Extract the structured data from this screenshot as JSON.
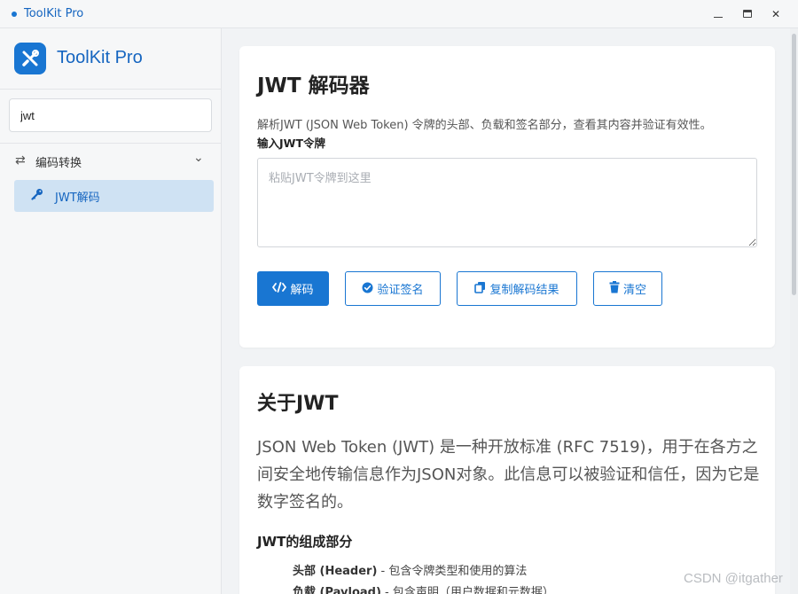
{
  "window": {
    "title": "ToolKit Pro",
    "accent_color": "#1976d2",
    "controls": {
      "minimize_icon": "minimize-icon",
      "maximize_icon": "maximize-icon",
      "close": "✕"
    }
  },
  "sidebar": {
    "brand_name": "ToolKit Pro",
    "brand_icon": "tools-icon",
    "search": {
      "value": "jwt",
      "placeholder": ""
    },
    "category": {
      "icon": "⇄",
      "label": "编码转换",
      "chevron": "⌄"
    },
    "items": [
      {
        "icon": "key-icon",
        "label": "JWT解码",
        "active": true
      }
    ]
  },
  "main": {
    "decoder": {
      "title": "JWT 解码器",
      "description": "解析JWT (JSON Web Token) 令牌的头部、负载和签名部分，查看其内容并验证有效性。",
      "input_label": "输入JWT令牌",
      "input_placeholder": "粘贴JWT令牌到这里",
      "input_value": "",
      "buttons": {
        "decode": {
          "icon": "code-icon",
          "label": "解码"
        },
        "verify": {
          "icon": "check-circle-icon",
          "label": "验证签名"
        },
        "copy": {
          "icon": "copy-icon",
          "label": "复制解码结果"
        },
        "clear": {
          "icon": "trash-icon",
          "label": "清空"
        }
      }
    },
    "about": {
      "title": "关于JWT",
      "paragraph": "JSON Web Token (JWT) 是一种开放标准 (RFC 7519)，用于在各方之间安全地传输信息作为JSON对象。此信息可以被验证和信任，因为它是数字签名的。",
      "parts_title": "JWT的组成部分",
      "parts": [
        {
          "name": "头部 (Header)",
          "desc": " - 包含令牌类型和使用的算法"
        },
        {
          "name": "负载 (Payload)",
          "desc": " - 包含声明（用户数据和元数据）"
        }
      ]
    }
  },
  "watermark": "CSDN @itgather"
}
